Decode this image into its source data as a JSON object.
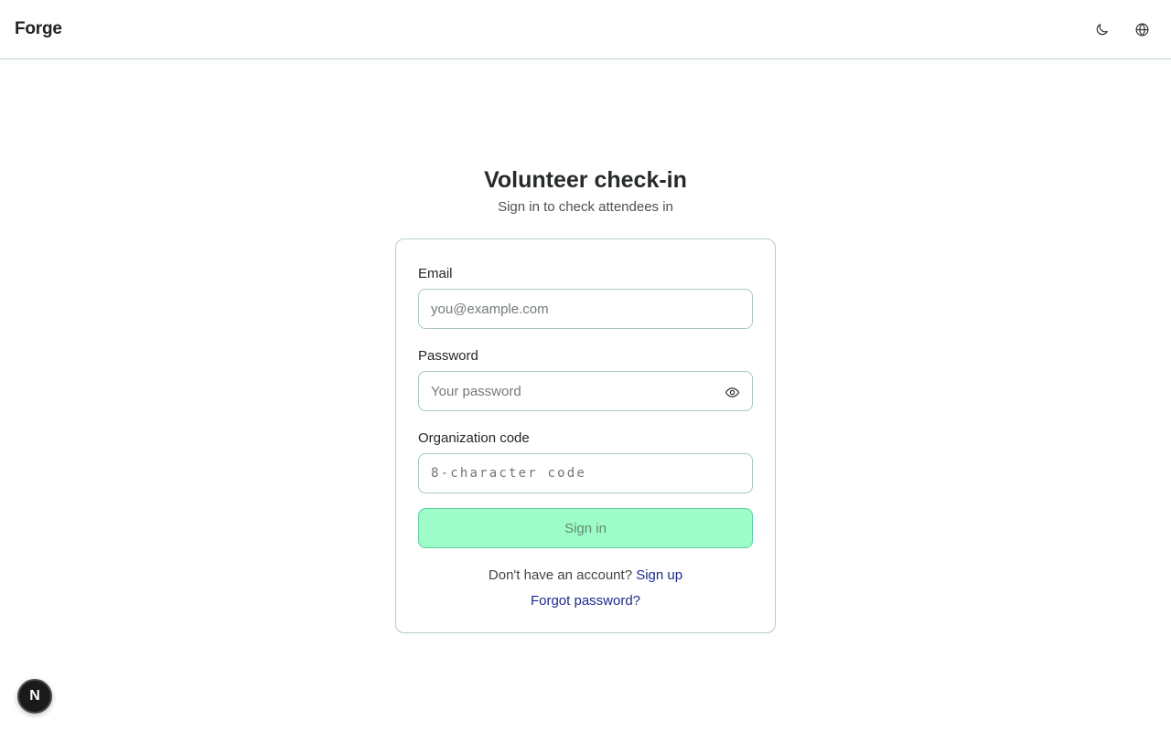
{
  "header": {
    "brand": "Forge",
    "theme_icon": "moon-icon",
    "language_icon": "globe-icon"
  },
  "page": {
    "title": "Volunteer check-in",
    "subtitle": "Sign in to check attendees in"
  },
  "form": {
    "email": {
      "label": "Email",
      "placeholder": "you@example.com",
      "value": ""
    },
    "password": {
      "label": "Password",
      "placeholder": "Your password",
      "value": "",
      "toggle_icon": "eye-icon"
    },
    "org_code": {
      "label": "Organization code",
      "placeholder": "8-character code",
      "value": ""
    },
    "submit_label": "Sign in"
  },
  "footer_links": {
    "signup_prompt": "Don't have an account?",
    "signup_link": "Sign up",
    "forgot_link": "Forgot password?"
  },
  "dev_badge": {
    "label": "N"
  },
  "colors": {
    "accent_button": "#9dfcc7",
    "link": "#1f2a8a",
    "border": "#b9cfc6"
  }
}
